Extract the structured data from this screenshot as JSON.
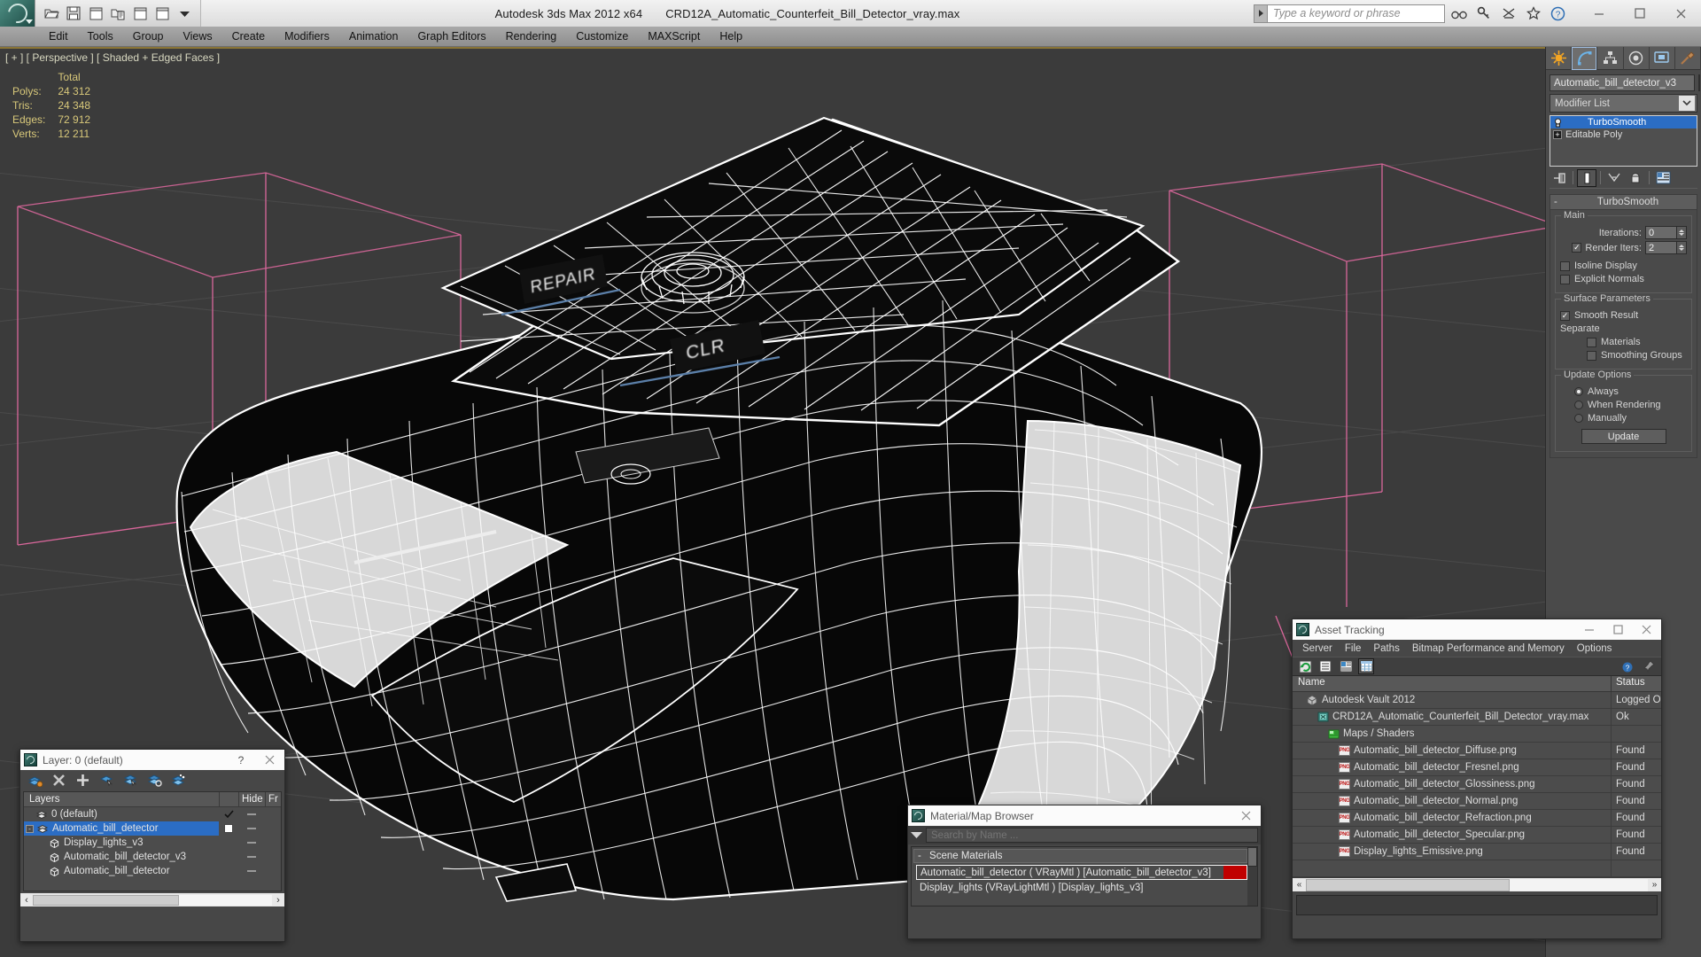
{
  "titlebar": {
    "app_title": "Autodesk 3ds Max  2012 x64",
    "file_name": "CRD12A_Automatic_Counterfeit_Bill_Detector_vray.max",
    "search_placeholder": "Type a keyword or phrase",
    "quick_tools": [
      "open-file-icon",
      "save-file-icon",
      "new-scene-icon",
      "import-icon",
      "window-icon",
      "window2-icon",
      "dropdown-arrow-icon"
    ],
    "help_icons": [
      "binoculars-icon",
      "key-icon",
      "satellite-icon",
      "star-icon",
      "question-icon"
    ],
    "window_controls": [
      "minimize",
      "maximize",
      "close"
    ]
  },
  "menubar": {
    "items": [
      "Edit",
      "Tools",
      "Group",
      "Views",
      "Create",
      "Modifiers",
      "Animation",
      "Graph Editors",
      "Rendering",
      "Customize",
      "MAXScript",
      "Help"
    ]
  },
  "viewport": {
    "label": "[ + ] [ Perspective ] [ Shaded + Edged Faces ]",
    "stats": {
      "header": "Total",
      "rows": [
        {
          "label": "Polys:",
          "value": "24 312"
        },
        {
          "label": "Tris:",
          "value": "24 348"
        },
        {
          "label": "Edges:",
          "value": "72 912"
        },
        {
          "label": "Verts:",
          "value": "12 211"
        }
      ]
    },
    "model_decals": [
      "REPAIR",
      "CLR"
    ]
  },
  "command_panel": {
    "tabs": [
      "create-tab",
      "modify-tab",
      "hierarchy-tab",
      "motion-tab",
      "display-tab",
      "utilities-tab"
    ],
    "active_tab_index": 1,
    "object_name": "Automatic_bill_detector_v3",
    "object_color": "#6c9bd2",
    "modifier_list_label": "Modifier List",
    "stack": [
      {
        "label": "TurboSmooth",
        "selected": true,
        "icon": "lightbulb-icon"
      },
      {
        "label": "Editable Poly",
        "selected": false,
        "icon": "plus-expand-icon"
      }
    ],
    "stack_buttons": [
      "pin-stack-icon",
      "show-end-result-icon",
      "make-unique-icon",
      "remove-modifier-icon",
      "configure-sets-icon"
    ],
    "rollout": {
      "title": "TurboSmooth",
      "collapse_sign": "-",
      "groups": [
        {
          "title": "Main",
          "fields": [
            {
              "type": "spinner",
              "label": "Iterations:",
              "value": "0"
            },
            {
              "type": "check-spinner",
              "label": "Render Iters:",
              "value": "2",
              "checked": true
            },
            {
              "type": "checkbox",
              "label": "Isoline Display",
              "checked": false
            },
            {
              "type": "checkbox",
              "label": "Explicit Normals",
              "checked": false
            }
          ]
        },
        {
          "title": "Surface Parameters",
          "fields": [
            {
              "type": "checkbox",
              "label": "Smooth Result",
              "checked": true
            },
            {
              "type": "text",
              "label": "Separate"
            },
            {
              "type": "checkbox-indent",
              "label": "Materials",
              "checked": false
            },
            {
              "type": "checkbox-indent",
              "label": "Smoothing Groups",
              "checked": false
            }
          ]
        },
        {
          "title": "Update Options",
          "fields": [
            {
              "type": "radio",
              "label": "Always",
              "checked": true
            },
            {
              "type": "radio",
              "label": "When Rendering",
              "checked": false
            },
            {
              "type": "radio",
              "label": "Manually",
              "checked": false
            },
            {
              "type": "button",
              "label": "Update"
            }
          ]
        }
      ]
    }
  },
  "layer_window": {
    "title": "Layer: 0 (default)",
    "help_label": "?",
    "close_label": "✕",
    "toolbar": [
      "create-new-layer-icon",
      "delete-layer-icon",
      "add-selection-icon",
      "select-objects-icon",
      "select-highlight-icon",
      "highlight-selected-icon",
      "layer-props-icon"
    ],
    "columns": [
      "Layers",
      "",
      "Hide",
      "Fr"
    ],
    "rows": [
      {
        "name": "0 (default)",
        "indent": 0,
        "icon": "layer-icon",
        "current": "check",
        "hide": "dash",
        "selected": false,
        "expander": ""
      },
      {
        "name": "Automatic_bill_detector",
        "indent": 0,
        "icon": "layer-icon",
        "current": "box",
        "hide": "dash",
        "selected": true,
        "expander": "-"
      },
      {
        "name": "Display_lights_v3",
        "indent": 1,
        "icon": "object-icon",
        "current": "",
        "hide": "dash",
        "selected": false,
        "expander": ""
      },
      {
        "name": "Automatic_bill_detector_v3",
        "indent": 1,
        "icon": "object-icon",
        "current": "",
        "hide": "dash",
        "selected": false,
        "expander": ""
      },
      {
        "name": "Automatic_bill_detector",
        "indent": 1,
        "icon": "object-icon",
        "current": "",
        "hide": "dash",
        "selected": false,
        "expander": ""
      }
    ],
    "scroll_left": "‹",
    "scroll_right": "›"
  },
  "material_browser": {
    "title": "Material/Map Browser",
    "close_label": "✕",
    "search_placeholder": "Search by Name ...",
    "group_label": "Scene Materials",
    "group_sign": "-",
    "items": [
      {
        "label": "Automatic_bill_detector  ( VRayMtl ) [Automatic_bill_detector_v3]",
        "selected": true,
        "swatch": "#c00000"
      },
      {
        "label": "Display_lights (VRayLightMtl ) [Display_lights_v3]",
        "selected": false,
        "swatch": ""
      }
    ]
  },
  "asset_tracking": {
    "title": "Asset Tracking",
    "window_controls": [
      "minimize",
      "maximize",
      "close"
    ],
    "menu": [
      "Server",
      "File",
      "Paths",
      "Bitmap Performance and Memory",
      "Options"
    ],
    "toolbar": [
      "refresh-icon",
      "list-view-icon",
      "detail-view-icon",
      "grid-view-icon"
    ],
    "toolbar_right": [
      "help-globe-icon",
      "pin-icon"
    ],
    "columns": [
      "Name",
      "Status"
    ],
    "rows": [
      {
        "name": "Autodesk Vault 2012",
        "status": "Logged O",
        "indent": 0,
        "icon": "vault-icon"
      },
      {
        "name": "CRD12A_Automatic_Counterfeit_Bill_Detector_vray.max",
        "status": "Ok",
        "indent": 1,
        "icon": "max-file-icon"
      },
      {
        "name": "Maps / Shaders",
        "status": "",
        "indent": 2,
        "icon": "maps-icon"
      },
      {
        "name": "Automatic_bill_detector_Diffuse.png",
        "status": "Found",
        "indent": 3,
        "icon": "png-icon"
      },
      {
        "name": "Automatic_bill_detector_Fresnel.png",
        "status": "Found",
        "indent": 3,
        "icon": "png-icon"
      },
      {
        "name": "Automatic_bill_detector_Glossiness.png",
        "status": "Found",
        "indent": 3,
        "icon": "png-icon"
      },
      {
        "name": "Automatic_bill_detector_Normal.png",
        "status": "Found",
        "indent": 3,
        "icon": "png-icon"
      },
      {
        "name": "Automatic_bill_detector_Refraction.png",
        "status": "Found",
        "indent": 3,
        "icon": "png-icon"
      },
      {
        "name": "Automatic_bill_detector_Specular.png",
        "status": "Found",
        "indent": 3,
        "icon": "png-icon"
      },
      {
        "name": "Display_lights_Emissive.png",
        "status": "Found",
        "indent": 3,
        "icon": "png-icon"
      }
    ],
    "scroll_left": "«",
    "scroll_right": "»"
  }
}
